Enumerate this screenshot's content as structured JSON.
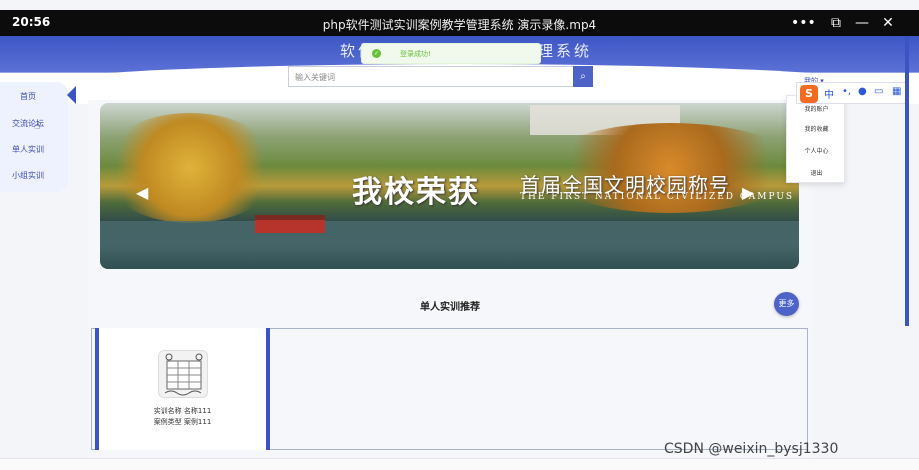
{
  "player": {
    "time": "20:56",
    "title": "php软件测试实训案例教学管理系统 演示录像.mp4",
    "controls": [
      "•••",
      "⧉",
      "—",
      "✕"
    ]
  },
  "header": {
    "site_title": "软件测试实训案例教学管理系统",
    "toast_message": "登录成功!",
    "search_placeholder": "输入关键词",
    "search_icon": "search-icon"
  },
  "sidebar": {
    "items": [
      {
        "label": "首页"
      },
      {
        "label": "交流论坛"
      },
      {
        "label": "单人实训"
      },
      {
        "label": "小组实训"
      }
    ]
  },
  "banner": {
    "main_text": "我校荣获",
    "sub_text": "首届全国文明校园称号",
    "en_text": "THE FIRST NATIONAL CIVILIZED CAMPUS"
  },
  "user_menu": {
    "trigger": "我的",
    "items": [
      {
        "label": "我的账户"
      },
      {
        "label": "我的收藏"
      },
      {
        "label": "个人中心"
      },
      {
        "label": "退出"
      }
    ]
  },
  "ime": {
    "logo": "S",
    "buttons": [
      "中",
      "•,",
      "🎤",
      "⌨",
      "▦"
    ]
  },
  "section": {
    "title": "单人实训推荐",
    "more_label": "更多",
    "cards": [
      {
        "name_label": "实训名称",
        "name_value": "名称111",
        "type_label": "案例类型",
        "type_value": "案例111"
      }
    ]
  },
  "watermark": "CSDN @weixin_bysj1330"
}
